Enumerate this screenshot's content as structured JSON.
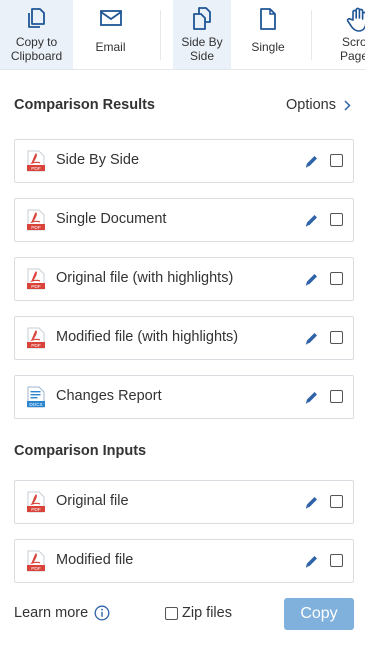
{
  "toolbar": {
    "copy_to_clipboard": "Copy to\nClipboard",
    "email": "Email",
    "side_by_side": "Side By\nSide",
    "single": "Single",
    "scroll_pages": "Scroll\nPages"
  },
  "results": {
    "title": "Comparison Results",
    "options_label": "Options",
    "items": [
      {
        "label": "Side By Side",
        "icon": "pdf-icon"
      },
      {
        "label": "Single Document",
        "icon": "pdf-icon"
      },
      {
        "label": "Original file (with highlights)",
        "icon": "pdf-icon"
      },
      {
        "label": "Modified file (with highlights)",
        "icon": "pdf-icon"
      },
      {
        "label": "Changes Report",
        "icon": "docx-icon"
      }
    ]
  },
  "inputs": {
    "title": "Comparison Inputs",
    "items": [
      {
        "label": "Original file",
        "icon": "pdf-icon"
      },
      {
        "label": "Modified file",
        "icon": "pdf-icon"
      }
    ]
  },
  "footer": {
    "learn_more": "Learn more",
    "zip_files": "Zip files",
    "copy_label": "Copy"
  },
  "colors": {
    "accent": "#2f63a8",
    "pdf_red": "#d9433a",
    "docx_blue": "#2a86d1",
    "copy_button": "#7fb1dc",
    "active_tab_bg": "#eaf1f9"
  }
}
